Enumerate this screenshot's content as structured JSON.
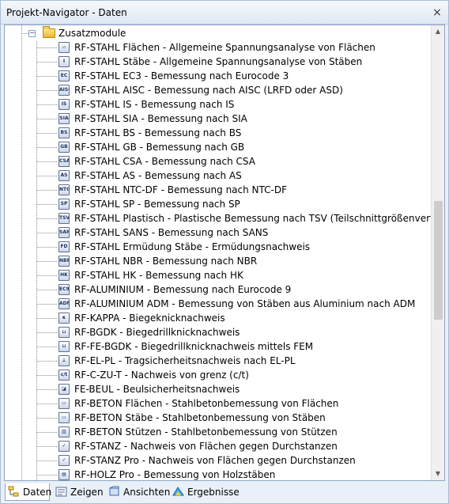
{
  "window": {
    "title": "Projekt-Navigator - Daten",
    "close_glyph": "×"
  },
  "tree": {
    "folder": {
      "label": "Zusatzmodule",
      "expander": "−"
    },
    "items": [
      {
        "icon": "rf-stahl-flaechen-icon",
        "glyph": "▱",
        "label": "RF-STAHL Flächen - Allgemeine Spannungsanalyse von Flächen"
      },
      {
        "icon": "rf-stahl-staebe-icon",
        "glyph": "Ⅰ",
        "label": "RF-STAHL Stäbe - Allgemeine Spannungsanalyse von Stäben"
      },
      {
        "icon": "rf-stahl-ec3-icon",
        "glyph": "EC",
        "label": "RF-STAHL EC3 - Bemessung nach Eurocode 3"
      },
      {
        "icon": "rf-stahl-aisc-icon",
        "glyph": "AISC",
        "label": "RF-STAHL AISC - Bemessung nach AISC (LRFD oder ASD)"
      },
      {
        "icon": "rf-stahl-is-icon",
        "glyph": "IS",
        "label": "RF-STAHL IS - Bemessung nach IS"
      },
      {
        "icon": "rf-stahl-sia-icon",
        "glyph": "SIA",
        "label": "RF-STAHL SIA - Bemessung nach SIA"
      },
      {
        "icon": "rf-stahl-bs-icon",
        "glyph": "BS",
        "label": "RF-STAHL BS - Bemessung nach BS"
      },
      {
        "icon": "rf-stahl-gb-icon",
        "glyph": "GB",
        "label": "RF-STAHL GB - Bemessung nach GB"
      },
      {
        "icon": "rf-stahl-csa-icon",
        "glyph": "CSA",
        "label": "RF-STAHL CSA - Bemessung nach CSA"
      },
      {
        "icon": "rf-stahl-as-icon",
        "glyph": "AS",
        "label": "RF-STAHL AS - Bemessung nach AS"
      },
      {
        "icon": "rf-stahl-ntc-df-icon",
        "glyph": "NTC",
        "label": "RF-STAHL NTC-DF - Bemessung nach NTC-DF"
      },
      {
        "icon": "rf-stahl-sp-icon",
        "glyph": "SP",
        "label": "RF-STAHL SP - Bemessung nach SP"
      },
      {
        "icon": "rf-stahl-plastisch-icon",
        "glyph": "TSV",
        "label": "RF-STAHL Plastisch - Plastische Bemessung nach TSV (Teilschnittgrößenverfahren)"
      },
      {
        "icon": "rf-stahl-sans-icon",
        "glyph": "SANS",
        "label": "RF-STAHL SANS - Bemessung nach SANS"
      },
      {
        "icon": "rf-stahl-ermuedung-icon",
        "glyph": "FD",
        "label": "RF-STAHL Ermüdung Stäbe - Ermüdungsnachweis"
      },
      {
        "icon": "rf-stahl-nbr-icon",
        "glyph": "NBR",
        "label": "RF-STAHL NBR - Bemessung nach NBR"
      },
      {
        "icon": "rf-stahl-hk-icon",
        "glyph": "HK",
        "label": "RF-STAHL HK - Bemessung nach HK"
      },
      {
        "icon": "rf-aluminium-icon",
        "glyph": "EC9",
        "label": "RF-ALUMINIUM - Bemessung nach Eurocode 9"
      },
      {
        "icon": "rf-aluminium-adm-icon",
        "glyph": "ADM",
        "label": "RF-ALUMINIUM ADM - Bemessung von Stäben aus Aluminium nach ADM"
      },
      {
        "icon": "rf-kappa-icon",
        "glyph": "κ",
        "label": "RF-KAPPA - Biegeknicknachweis"
      },
      {
        "icon": "rf-bgdk-icon",
        "glyph": "⊔",
        "label": "RF-BGDK - Biegedrillknicknachweis"
      },
      {
        "icon": "rf-fe-bgdk-icon",
        "glyph": "⊔",
        "label": "RF-FE-BGDK - Biegedrillknicknachweis mittels FEM"
      },
      {
        "icon": "rf-el-pl-icon",
        "glyph": "⊥",
        "label": "RF-EL-PL - Tragsicherheitsnachweis nach EL-PL"
      },
      {
        "icon": "rf-c-zu-t-icon",
        "glyph": "c/t",
        "label": "RF-C-ZU-T - Nachweis von grenz (c/t)"
      },
      {
        "icon": "fe-beul-icon",
        "glyph": "◪",
        "label": "FE-BEUL - Beulsicherheitsnachweis"
      },
      {
        "icon": "rf-beton-flaechen-icon",
        "glyph": "▭",
        "label": "RF-BETON Flächen - Stahlbetonbemessung von Flächen"
      },
      {
        "icon": "rf-beton-staebe-icon",
        "glyph": "▭",
        "label": "RF-BETON Stäbe - Stahlbetonbemessung von Stäben"
      },
      {
        "icon": "rf-beton-stuetzen-icon",
        "glyph": "▥",
        "label": "RF-BETON Stützen - Stahlbetonbemessung von Stützen"
      },
      {
        "icon": "rf-stanz-icon",
        "glyph": "✓",
        "label": "RF-STANZ - Nachweis von Flächen gegen Durchstanzen"
      },
      {
        "icon": "rf-stanz-pro-icon",
        "glyph": "✓",
        "label": "RF-STANZ Pro - Nachweis von Flächen gegen Durchstanzen"
      },
      {
        "icon": "rf-holz-pro-icon",
        "glyph": "▤",
        "label": "RF-HOLZ Pro - Bemessung von Holzstäben"
      }
    ]
  },
  "scrollbar": {
    "up": "▲",
    "down": "▼"
  },
  "tabs": [
    {
      "name": "tab-daten",
      "icon": "data-tree-icon",
      "label": "Daten",
      "active": true
    },
    {
      "name": "tab-zeigen",
      "icon": "display-icon",
      "label": "Zeigen",
      "active": false
    },
    {
      "name": "tab-ansichten",
      "icon": "views-icon",
      "label": "Ansichten",
      "active": false
    },
    {
      "name": "tab-ergebnisse",
      "icon": "results-icon",
      "label": "Ergebnisse",
      "active": false
    }
  ],
  "colors": {
    "window_bg": "#eaf0f8",
    "border": "#8fa5c2",
    "folder": "#e9b634",
    "text": "#000000"
  }
}
